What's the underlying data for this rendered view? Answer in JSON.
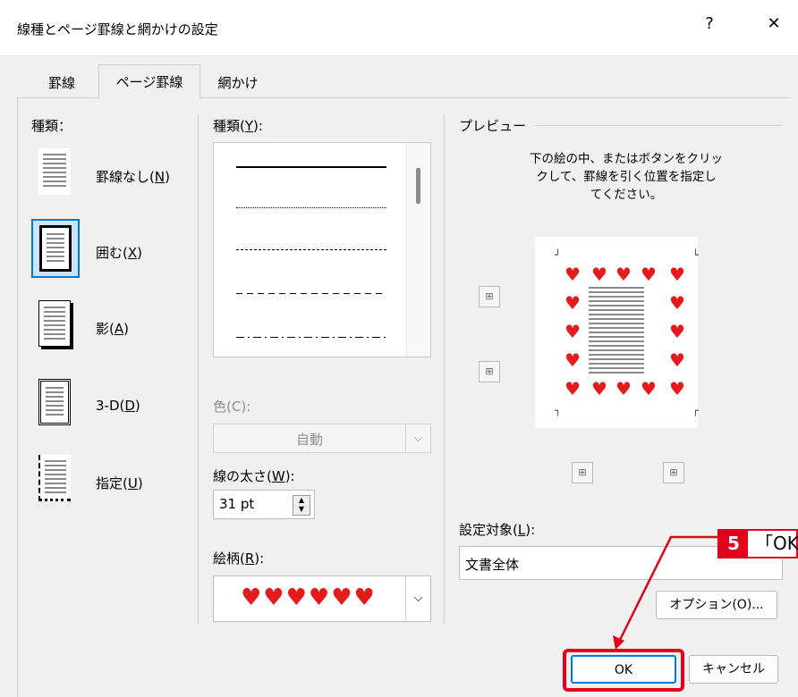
{
  "dialog": {
    "title": "線種とページ罫線と網かけの設定",
    "help_glyph": "?",
    "close_glyph": "✕"
  },
  "tabs": [
    "罫線",
    "ページ罫線",
    "網かけ"
  ],
  "active_tab": "ページ罫線",
  "settings": {
    "heading": "種類：",
    "items": [
      {
        "label": "罫線なし(",
        "key": "N",
        "suffix": ")"
      },
      {
        "label": "囲む(",
        "key": "X",
        "suffix": ")"
      },
      {
        "label": "影(",
        "key": "A",
        "suffix": ")"
      },
      {
        "label": "3-D(",
        "key": "D",
        "suffix": ")"
      },
      {
        "label": "指定(",
        "key": "U",
        "suffix": ")"
      }
    ],
    "selected": "囲む"
  },
  "style": {
    "heading": "種類(",
    "heading_key": "Y",
    "heading_suffix": "):",
    "line_styles": [
      "solid",
      "dotted",
      "dashed-fine",
      "dashed",
      "dash-dot"
    ]
  },
  "color": {
    "label": "色(C):",
    "value": "自動"
  },
  "width": {
    "label": "線の太さ(",
    "key": "W",
    "suffix": "):",
    "value": "31 pt"
  },
  "art": {
    "label": "絵柄(",
    "key": "R",
    "suffix": "):",
    "value": "♥♥♥♥♥♥"
  },
  "preview": {
    "heading": "プレビュー",
    "instruction_lines": [
      "下の絵の中、またはボタンをクリッ",
      "クして、罫線を引く位置を指定し",
      "てください。"
    ]
  },
  "apply_to": {
    "label": "設定対象(",
    "key": "L",
    "suffix": "):",
    "value": "文書全体"
  },
  "buttons": {
    "options": "オプション(O)...",
    "ok": "OK",
    "cancel": "キャンセル"
  },
  "callout": {
    "number": "5",
    "text": "「OK」"
  },
  "colors": {
    "accent_red": "#e3001b",
    "heart_red": "#e31b1b",
    "selection_blue": "#0078d4"
  }
}
